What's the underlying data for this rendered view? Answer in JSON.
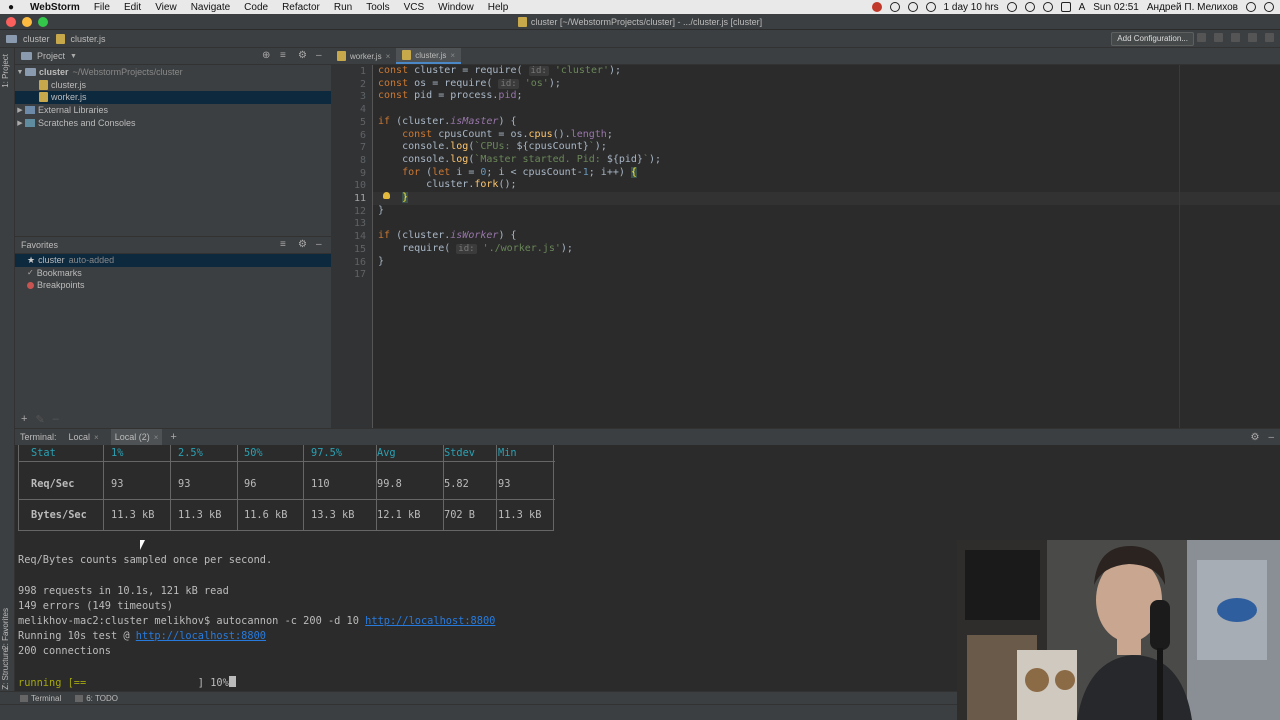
{
  "menubar": {
    "app_name": "WebStorm",
    "items": [
      "File",
      "Edit",
      "View",
      "Navigate",
      "Code",
      "Refactor",
      "Run",
      "Tools",
      "VCS",
      "Window",
      "Help"
    ],
    "uptime": "1 day 10 hrs",
    "input_source": "A",
    "clock": "Sun 02:51",
    "user": "Андрей П. Мелихов"
  },
  "window": {
    "title": "cluster [~/WebstormProjects/cluster] - .../cluster.js [cluster]"
  },
  "navbar": {
    "breadcrumb_project": "cluster",
    "breadcrumb_file": "cluster.js",
    "add_configuration": "Add Configuration..."
  },
  "left_stripe": {
    "project_tab": "1: Project",
    "favorites_tab": "2: Favorites",
    "structure_tab": "Z: Structure"
  },
  "project_panel": {
    "header": "Project",
    "root_name": "cluster",
    "root_path": "~/WebstormProjects/cluster",
    "files": [
      "cluster.js",
      "worker.js"
    ],
    "external_libraries": "External Libraries",
    "scratches": "Scratches and Consoles"
  },
  "favorites_panel": {
    "header": "Favorites",
    "item_cluster": "cluster",
    "item_cluster_note": "auto-added",
    "bookmarks": "Bookmarks",
    "breakpoints": "Breakpoints"
  },
  "editor": {
    "tabs": [
      "worker.js",
      "cluster.js"
    ],
    "line_numbers": [
      "1",
      "2",
      "3",
      "4",
      "5",
      "6",
      "7",
      "8",
      "9",
      "10",
      "11",
      "12",
      "13",
      "14",
      "15",
      "16",
      "17"
    ],
    "current_line": "11",
    "code": {
      "l1_kw": "const",
      "l1_a": " cluster = require(",
      "l1_hint": "id:",
      "l1_str": "'cluster'",
      "l1_b": ");",
      "l2_kw": "const",
      "l2_a": " os = require(",
      "l2_hint": "id:",
      "l2_str": "'os'",
      "l2_b": ");",
      "l3_kw": "const",
      "l3_a": " pid = process.",
      "l3_prop": "pid",
      "l3_b": ";",
      "l5_kw": "if",
      "l5_a": " (cluster.",
      "l5_prop": "isMaster",
      "l5_b": ") {",
      "l6_kw": "const",
      "l6_a": " cpusCount = os.",
      "l6_fn": "cpus",
      "l6_b": "().",
      "l6_prop": "length",
      "l6_c": ";",
      "l7_a": "console.",
      "l7_fn": "log",
      "l7_b": "(",
      "l7_str": "`CPUs: ",
      "l7_tpl": "${cpusCount}",
      "l7_str2": "`",
      "l7_c": ");",
      "l8_a": "console.",
      "l8_fn": "log",
      "l8_b": "(",
      "l8_str": "`Master started. Pid: ",
      "l8_tpl": "${pid}",
      "l8_str2": "`",
      "l8_c": ");",
      "l9_kw": "for",
      "l9_a": " (",
      "l9_kw2": "let",
      "l9_b": " i = ",
      "l9_num": "0",
      "l9_c": "; i < cpusCount-",
      "l9_num2": "1",
      "l9_d": "; i++) ",
      "l9_brace": "{",
      "l10_a": "cluster.",
      "l10_fn": "fork",
      "l10_b": "();",
      "l11_brace": "}",
      "l12": "}",
      "l14_kw": "if",
      "l14_a": " (cluster.",
      "l14_prop": "isWorker",
      "l14_b": ") {",
      "l15_a": "require(",
      "l15_hint": "id:",
      "l15_str": "'./worker.js'",
      "l15_b": ");",
      "l16": "}"
    }
  },
  "terminal_header": {
    "label": "Terminal:",
    "tabs": [
      "Local",
      "Local (2)"
    ],
    "add": "+"
  },
  "terminal": {
    "table_headers": [
      "Stat",
      "1%",
      "2.5%",
      "50%",
      "97.5%",
      "Avg",
      "Stdev",
      "Min"
    ],
    "row_req": [
      "Req/Sec",
      "93",
      "93",
      "96",
      "110",
      "99.8",
      "5.82",
      "93"
    ],
    "row_bytes": [
      "Bytes/Sec",
      "11.3 kB",
      "11.3 kB",
      "11.6 kB",
      "13.3 kB",
      "12.1 kB",
      "702 B",
      "11.3 kB"
    ],
    "line_sampled": "Req/Bytes counts sampled once per second.",
    "line_requests": "998 requests in 10.1s, 121 kB read",
    "line_errors": "149 errors (149 timeouts)",
    "prompt": "melikhov-mac2:cluster melikhov$ autocannon -c 200 -d 10 ",
    "prompt_url": "http://localhost:8800",
    "running_test": "Running 10s test @ ",
    "running_url": "http://localhost:8800",
    "connections": "200 connections",
    "progress_label": "running [==",
    "progress_end": "] 10%",
    "progress_value": 0.1
  },
  "statusbar": {
    "terminal": "Terminal",
    "todo": "6: TODO"
  },
  "colors": {
    "keyword": "#cc7832",
    "string": "#6a8759",
    "property": "#9876aa",
    "function": "#ffc66d",
    "link": "#287bde",
    "table_header": "#2aa1b3"
  }
}
